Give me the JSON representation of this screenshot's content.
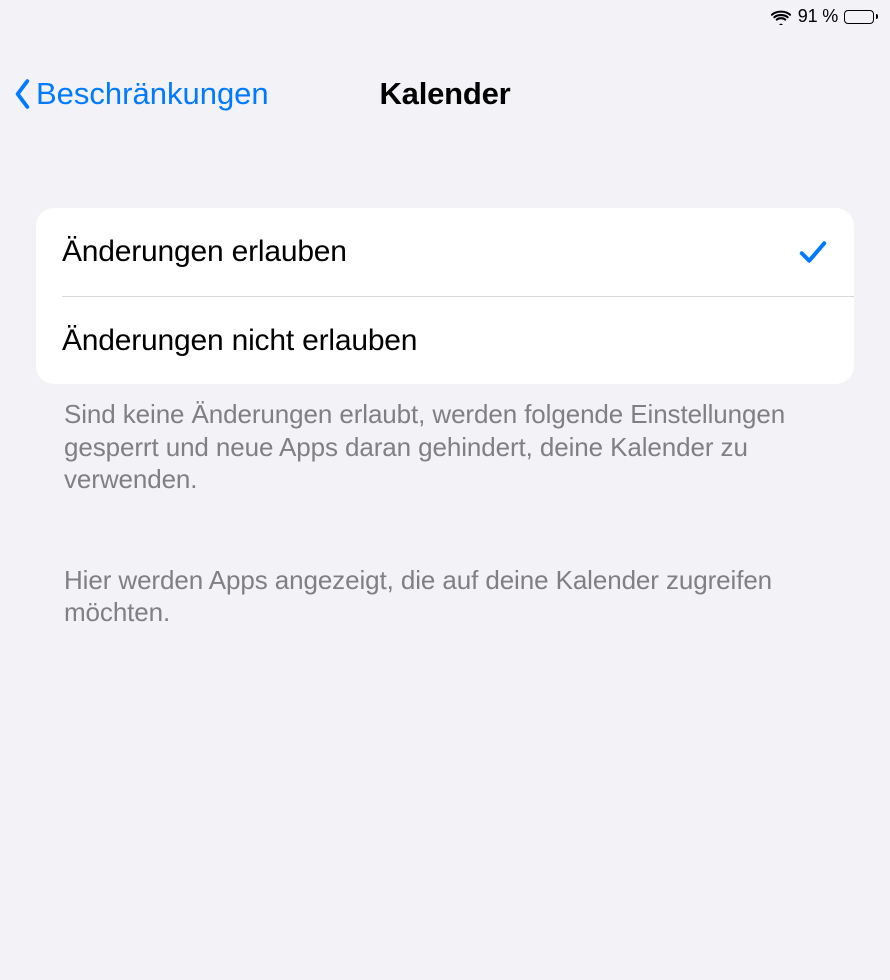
{
  "status_bar": {
    "battery_percent_text": "91 %",
    "battery_fraction": 0.91
  },
  "nav": {
    "back_label": "Beschränkungen",
    "title": "Kalender"
  },
  "options": [
    {
      "label": "Änderungen erlauben",
      "selected": true
    },
    {
      "label": "Änderungen nicht erlauben",
      "selected": false
    }
  ],
  "footer": {
    "p1": "Sind keine Änderungen erlaubt, werden folgende Einstellungen gesperrt und neue Apps daran gehindert, deine Kalender zu verwenden.",
    "p2": "Hier werden Apps angezeigt, die auf deine Kalender zugreifen möchten."
  }
}
